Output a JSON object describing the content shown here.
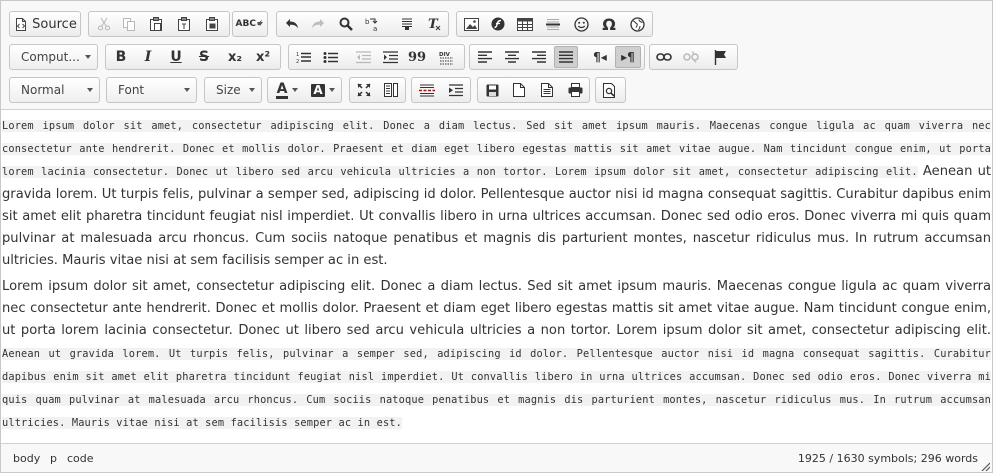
{
  "toolbar": {
    "source_label": "Source",
    "format_value": "Comput...",
    "style_value": "Normal",
    "font_value": "Font",
    "size_value": "Size",
    "text_color_letter": "A",
    "bg_color_letter": "A",
    "omega_symbol": "Ω",
    "italic_letter": "I",
    "underline_letter": "U",
    "strike_letter": "S",
    "bold_letter": "B",
    "subscript_label": "x₂",
    "superscript_label": "x²",
    "quote_symbol": "99",
    "ltr_symbol": "¶◂",
    "rtl_symbol": "▸¶"
  },
  "content": {
    "p1_code": "Lorem ipsum dolor sit amet, consectetur adipiscing elit. Donec a diam lectus. Sed sit amet ipsum mauris. Maecenas congue ligula ac quam viverra nec consectetur ante hendrerit. Donec et mollis dolor. Praesent et diam eget libero egestas mattis sit amet vitae augue. Nam tincidunt congue enim, ut porta lorem lacinia consectetur. Donec ut libero sed arcu vehicula ultricies a non tortor. Lorem ipsum dolor sit amet, consectetur adipiscing elit.",
    "p1_text": " Aenean ut gravida lorem. Ut turpis felis, pulvinar a semper sed, adipiscing id dolor. Pellentesque auctor nisi id magna consequat sagittis. Curabitur dapibus enim sit amet elit pharetra tincidunt feugiat nisl imperdiet. Ut convallis libero in urna ultrices accumsan. Donec sed odio eros. Donec viverra mi quis quam pulvinar at malesuada arcu rhoncus. Cum sociis natoque penatibus et magnis dis parturient montes, nascetur ridiculus mus. In rutrum accumsan ultricies. Mauris vitae nisi at sem facilisis semper ac in est.",
    "p2_text": "Lorem ipsum dolor sit amet, consectetur adipiscing elit. Donec a diam lectus. Sed sit amet ipsum mauris. Maecenas congue ligula ac quam viverra nec consectetur ante hendrerit. Donec et mollis dolor. Praesent et diam eget libero egestas mattis sit amet vitae augue. Nam tincidunt congue enim, ut porta lorem lacinia consectetur. Donec ut libero sed arcu vehicula ultricies a non tortor. Lorem ipsum dolor sit amet, consectetur adipiscing elit.",
    "p2_code": " Aenean ut gravida lorem. Ut turpis felis, pulvinar a semper sed, adipiscing id dolor. Pellentesque auctor nisi id magna consequat sagittis. Curabitur dapibus enim sit amet elit pharetra tincidunt feugiat nisl imperdiet. Ut convallis libero in urna ultrices accumsan. Donec sed odio eros. Donec viverra mi quis quam pulvinar at malesuada arcu rhoncus. Cum sociis natoque penatibus et magnis dis parturient montes, nascetur ridiculus mus. In rutrum accumsan ultricies. Mauris vitae nisi at sem facilisis semper ac in est."
  },
  "statusbar": {
    "path": [
      "body",
      "p",
      "code"
    ],
    "count": "1925 / 1630 symbols; 296 words"
  }
}
